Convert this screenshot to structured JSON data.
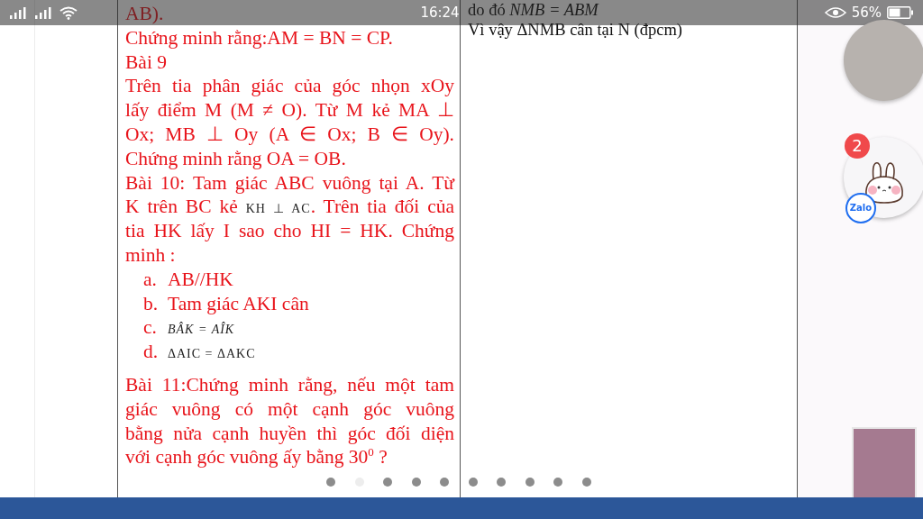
{
  "status_bar": {
    "time": "16:24",
    "battery_percent": "56%"
  },
  "document": {
    "left_column": {
      "blocks": [
        {
          "kind": "line",
          "parts": [
            {
              "kind": "text",
              "text": "AB)."
            }
          ]
        },
        {
          "kind": "line",
          "parts": [
            {
              "kind": "text",
              "text": "Chứng minh rằng:AM = BN = CP."
            }
          ]
        },
        {
          "kind": "line",
          "parts": [
            {
              "kind": "text",
              "text": "Bài 9"
            }
          ]
        },
        {
          "kind": "justified",
          "parts": [
            {
              "kind": "text",
              "text": "Trên tia phân giác của góc nhọn xOy"
            }
          ]
        },
        {
          "kind": "justified",
          "parts": [
            {
              "kind": "text",
              "text": "lấy điểm M (M ≠ O). Từ  M kẻ MA  ⊥"
            }
          ]
        },
        {
          "kind": "justified",
          "parts": [
            {
              "kind": "text",
              "text": "Ox; MB  ⊥ Oy (A ∈ Ox; B ∈ Oy)."
            }
          ]
        },
        {
          "kind": "line",
          "parts": [
            {
              "kind": "text",
              "text": "Chứng minh rằng OA = OB."
            }
          ]
        },
        {
          "kind": "justified",
          "parts": [
            {
              "kind": "text",
              "text": "Bài 10: Tam giác ABC vuông tại A. Từ"
            }
          ]
        },
        {
          "kind": "justified",
          "parts": [
            {
              "kind": "text",
              "text": "K trên BC kẻ "
            },
            {
              "kind": "math",
              "text": "KH ⊥ AC"
            },
            {
              "kind": "text",
              "text": ". Trên tia đối của"
            }
          ]
        },
        {
          "kind": "justified",
          "parts": [
            {
              "kind": "text",
              "text": "tia HK lấy I sao cho HI = HK. Chứng"
            }
          ]
        },
        {
          "kind": "line",
          "parts": [
            {
              "kind": "text",
              "text": "minh :"
            }
          ]
        },
        {
          "kind": "item",
          "marker": "a.",
          "parts": [
            {
              "kind": "text",
              "text": "AB//HK"
            }
          ]
        },
        {
          "kind": "item",
          "marker": "b.",
          "parts": [
            {
              "kind": "text",
              "text": "Tam giác AKI cân"
            }
          ]
        },
        {
          "kind": "item",
          "marker": "c.",
          "parts": [
            {
              "kind": "math-italic",
              "text": "BÂK = AÎK"
            }
          ]
        },
        {
          "kind": "item",
          "marker": "d.",
          "parts": [
            {
              "kind": "math",
              "text": "ΔAIC = ΔAKC"
            }
          ]
        },
        {
          "kind": "justified",
          "parts": [
            {
              "kind": "text",
              "text": "Bài 11:Chứng minh rằng, nếu một tam"
            }
          ]
        },
        {
          "kind": "justified",
          "parts": [
            {
              "kind": "text",
              "text": "giác vuông có một cạnh góc vuông"
            }
          ]
        },
        {
          "kind": "justified",
          "parts": [
            {
              "kind": "text",
              "text": "bằng nửa cạnh huyền thì góc đối diện"
            }
          ]
        },
        {
          "kind": "line",
          "parts": [
            {
              "kind": "text",
              "text": "với cạnh góc vuông ấy bằng 30$^{0}$ ?"
            }
          ]
        }
      ]
    },
    "middle_column": {
      "lines": [
        "do đó *NMB = ABM*",
        "Vì vậy ΔNMB cân tại N (đpcm)"
      ]
    }
  },
  "pager": [
    {
      "selected": false
    },
    {
      "selected": true
    },
    {
      "selected": false
    },
    {
      "selected": false
    },
    {
      "selected": false
    },
    {
      "selected": false
    },
    {
      "selected": false
    },
    {
      "selected": false
    },
    {
      "selected": false
    },
    {
      "selected": false
    }
  ],
  "chat_heads": [
    {
      "kind": "photo"
    },
    {
      "kind": "sticker",
      "badge": "2",
      "app_label": "Zalo"
    }
  ]
}
